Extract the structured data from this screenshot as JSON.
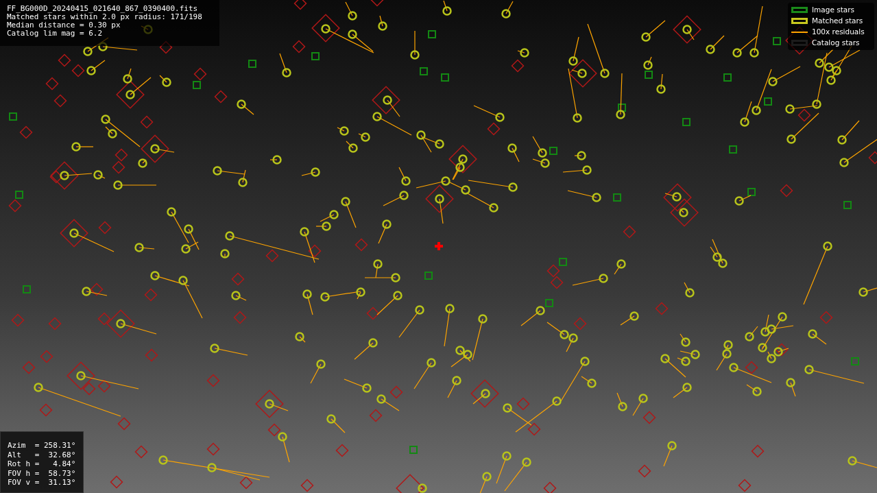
{
  "info_lines": [
    "FF_BG000D_20240415_021640_867_0390400.fits",
    "Matched stars within 2.0 px radius: 171/198",
    "Median distance = 0.30 px",
    "Catalog lim mag = 6.2"
  ],
  "legend": [
    {
      "label": "Image stars",
      "kind": "box",
      "color": "#1a8a1a"
    },
    {
      "label": "Matched stars",
      "kind": "box",
      "color": "#c8c81e"
    },
    {
      "label": "100x residuals",
      "kind": "line",
      "color": "#ffa500"
    },
    {
      "label": "Catalog stars",
      "kind": "box",
      "color": "#1c1c1c"
    }
  ],
  "pointing": [
    "Azim  = 258.31°",
    "Alt   =  32.68°",
    "Rot h =   4.84°",
    "FOV h =  58.73°",
    "FOV v =  31.13°"
  ]
}
